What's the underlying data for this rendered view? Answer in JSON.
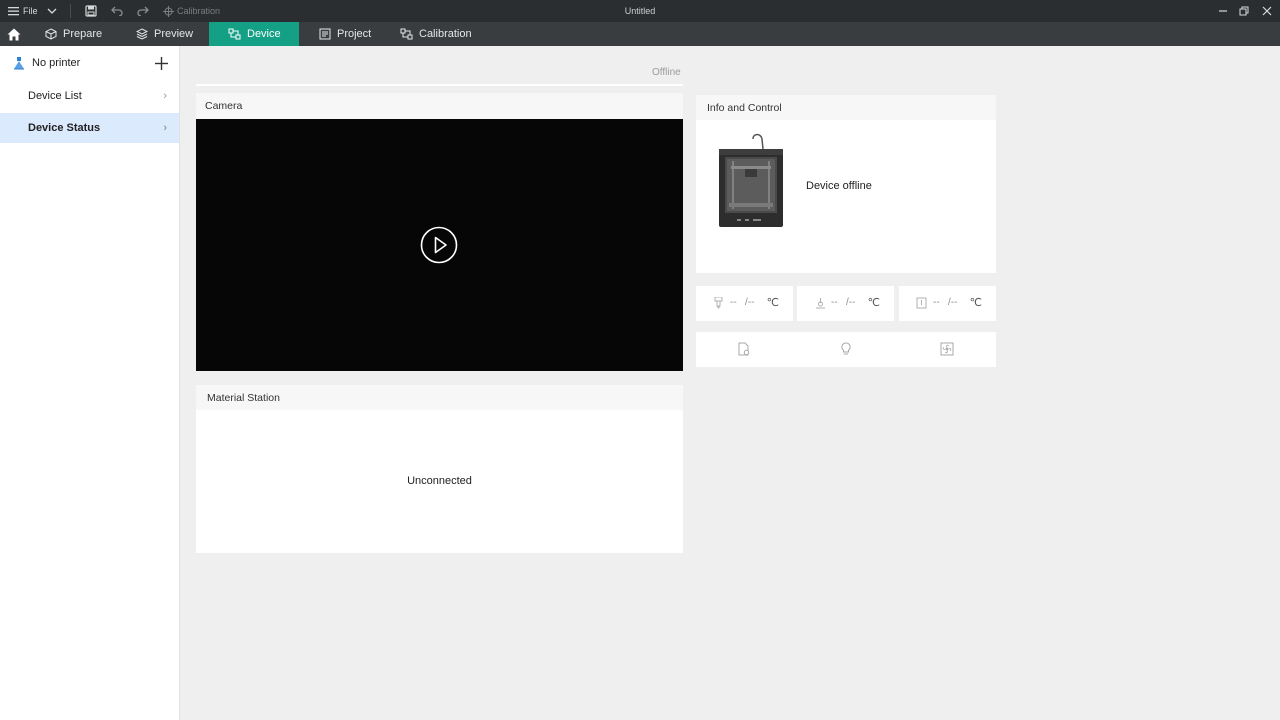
{
  "titlebar": {
    "file_label": "File",
    "calibration_label": "Calibration",
    "window_title": "Untitled"
  },
  "nav": {
    "tabs": [
      {
        "label": "Prepare",
        "icon": "cube-icon"
      },
      {
        "label": "Preview",
        "icon": "layers-icon"
      },
      {
        "label": "Device",
        "icon": "device-icon",
        "active": true
      },
      {
        "label": "Project",
        "icon": "project-icon"
      },
      {
        "label": "Calibration",
        "icon": "calibration-icon"
      }
    ]
  },
  "sidebar": {
    "printer_label": "No printer",
    "items": [
      {
        "label": "Device List"
      },
      {
        "label": "Device Status",
        "selected": true
      }
    ]
  },
  "status": {
    "connection": "Offline"
  },
  "camera": {
    "title": "Camera"
  },
  "material": {
    "title": "Material Station",
    "state": "Unconnected"
  },
  "info": {
    "title": "Info and Control",
    "device_state": "Device offline"
  },
  "temps": [
    {
      "name": "nozzle",
      "current": "--",
      "target": "/--",
      "unit": "℃"
    },
    {
      "name": "bed",
      "current": "--",
      "target": "/--",
      "unit": "℃"
    },
    {
      "name": "chamber",
      "current": "--",
      "target": "/--",
      "unit": "℃"
    }
  ],
  "colors": {
    "accent": "#14a085",
    "titlebar": "#2b2e31",
    "navbar": "#3a3d40",
    "selected_row": "#dbeafd"
  }
}
